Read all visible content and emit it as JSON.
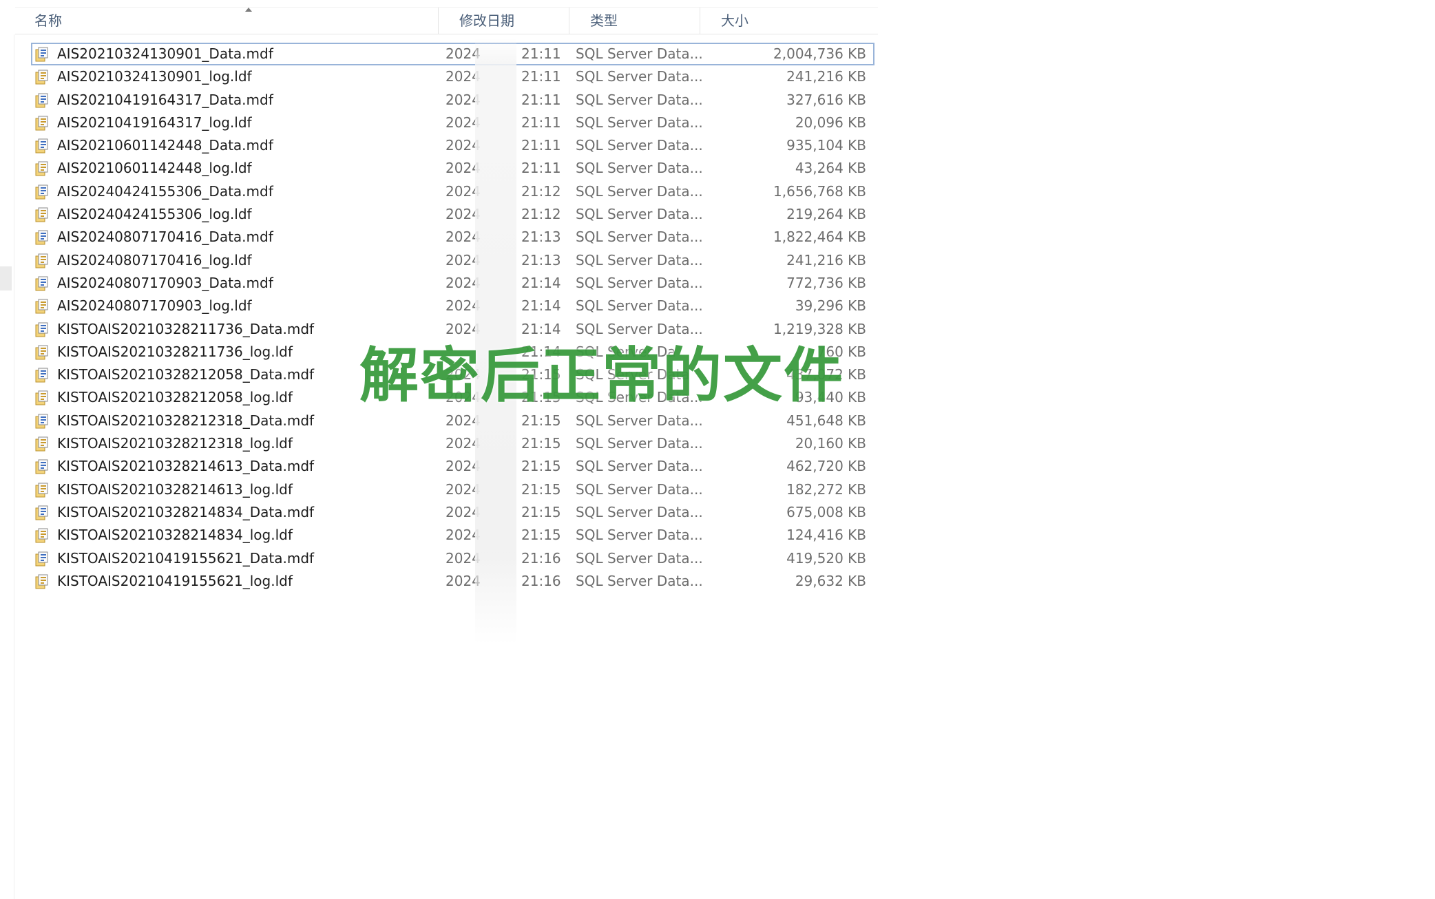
{
  "columns": {
    "name": "名称",
    "date": "修改日期",
    "type": "类型",
    "size": "大小"
  },
  "files": [
    {
      "name": "AIS20210324130901_Data.mdf",
      "date": "2024",
      "time": "21:11",
      "type": "SQL Server Data...",
      "size": "2,004,736 KB",
      "kind": "mdf",
      "selected": true
    },
    {
      "name": "AIS20210324130901_log.ldf",
      "date": "2024",
      "time": "21:11",
      "type": "SQL Server Data...",
      "size": "241,216 KB",
      "kind": "ldf"
    },
    {
      "name": "AIS20210419164317_Data.mdf",
      "date": "2024",
      "time": "21:11",
      "type": "SQL Server Data...",
      "size": "327,616 KB",
      "kind": "mdf"
    },
    {
      "name": "AIS20210419164317_log.ldf",
      "date": "2024",
      "time": "21:11",
      "type": "SQL Server Data...",
      "size": "20,096 KB",
      "kind": "ldf"
    },
    {
      "name": "AIS20210601142448_Data.mdf",
      "date": "2024",
      "time": "21:11",
      "type": "SQL Server Data...",
      "size": "935,104 KB",
      "kind": "mdf"
    },
    {
      "name": "AIS20210601142448_log.ldf",
      "date": "2024",
      "time": "21:11",
      "type": "SQL Server Data...",
      "size": "43,264 KB",
      "kind": "ldf"
    },
    {
      "name": "AIS20240424155306_Data.mdf",
      "date": "2024",
      "time": "21:12",
      "type": "SQL Server Data...",
      "size": "1,656,768 KB",
      "kind": "mdf"
    },
    {
      "name": "AIS20240424155306_log.ldf",
      "date": "2024",
      "time": "21:12",
      "type": "SQL Server Data...",
      "size": "219,264 KB",
      "kind": "ldf"
    },
    {
      "name": "AIS20240807170416_Data.mdf",
      "date": "2024",
      "time": "21:13",
      "type": "SQL Server Data...",
      "size": "1,822,464 KB",
      "kind": "mdf"
    },
    {
      "name": "AIS20240807170416_log.ldf",
      "date": "2024",
      "time": "21:13",
      "type": "SQL Server Data...",
      "size": "241,216 KB",
      "kind": "ldf"
    },
    {
      "name": "AIS20240807170903_Data.mdf",
      "date": "2024",
      "time": "21:14",
      "type": "SQL Server Data...",
      "size": "772,736 KB",
      "kind": "mdf"
    },
    {
      "name": "AIS20240807170903_log.ldf",
      "date": "2024",
      "time": "21:14",
      "type": "SQL Server Data...",
      "size": "39,296 KB",
      "kind": "ldf"
    },
    {
      "name": "KISTOAIS20210328211736_Data.mdf",
      "date": "2024",
      "time": "21:14",
      "type": "SQL Server Data...",
      "size": "1,219,328 KB",
      "kind": "mdf"
    },
    {
      "name": "KISTOAIS20210328211736_log.ldf",
      "date": "",
      "time": "21:14",
      "type": "SQL Server Da",
      "size": "760 KB",
      "kind": "ldf"
    },
    {
      "name": "KISTOAIS20210328212058_Data.mdf",
      "date": "2024",
      "time": "21:15",
      "type": "SQL Server Data",
      "size": "437,072 KB",
      "kind": "mdf"
    },
    {
      "name": "KISTOAIS20210328212058_log.ldf",
      "date": "2024",
      "time": "21:15",
      "type": "SQL Server Data...",
      "size": "93,440 KB",
      "kind": "ldf"
    },
    {
      "name": "KISTOAIS20210328212318_Data.mdf",
      "date": "2024",
      "time": "21:15",
      "type": "SQL Server Data...",
      "size": "451,648 KB",
      "kind": "mdf"
    },
    {
      "name": "KISTOAIS20210328212318_log.ldf",
      "date": "2024",
      "time": "21:15",
      "type": "SQL Server Data...",
      "size": "20,160 KB",
      "kind": "ldf"
    },
    {
      "name": "KISTOAIS20210328214613_Data.mdf",
      "date": "2024",
      "time": "21:15",
      "type": "SQL Server Data...",
      "size": "462,720 KB",
      "kind": "mdf"
    },
    {
      "name": "KISTOAIS20210328214613_log.ldf",
      "date": "2024",
      "time": "21:15",
      "type": "SQL Server Data...",
      "size": "182,272 KB",
      "kind": "ldf"
    },
    {
      "name": "KISTOAIS20210328214834_Data.mdf",
      "date": "2024",
      "time": "21:15",
      "type": "SQL Server Data...",
      "size": "675,008 KB",
      "kind": "mdf"
    },
    {
      "name": "KISTOAIS20210328214834_log.ldf",
      "date": "2024",
      "time": "21:15",
      "type": "SQL Server Data...",
      "size": "124,416 KB",
      "kind": "ldf"
    },
    {
      "name": "KISTOAIS20210419155621_Data.mdf",
      "date": "2024",
      "time": "21:16",
      "type": "SQL Server Data...",
      "size": "419,520 KB",
      "kind": "mdf"
    },
    {
      "name": "KISTOAIS20210419155621_log.ldf",
      "date": "2024",
      "time": "21:16",
      "type": "SQL Server Data...",
      "size": "29,632 KB",
      "kind": "ldf"
    }
  ],
  "caption": "解密后正常的文件",
  "colors": {
    "caption": "#3a9b3f",
    "selection_border": "#99b4d9",
    "header_text": "#4c607a",
    "icon_mdf_accent": "#3f6fc0",
    "icon_ldf_accent": "#c99a2e"
  },
  "icons": {
    "mdf": "database-file-icon",
    "ldf": "log-file-icon",
    "sort": "sort-ascending-icon"
  }
}
